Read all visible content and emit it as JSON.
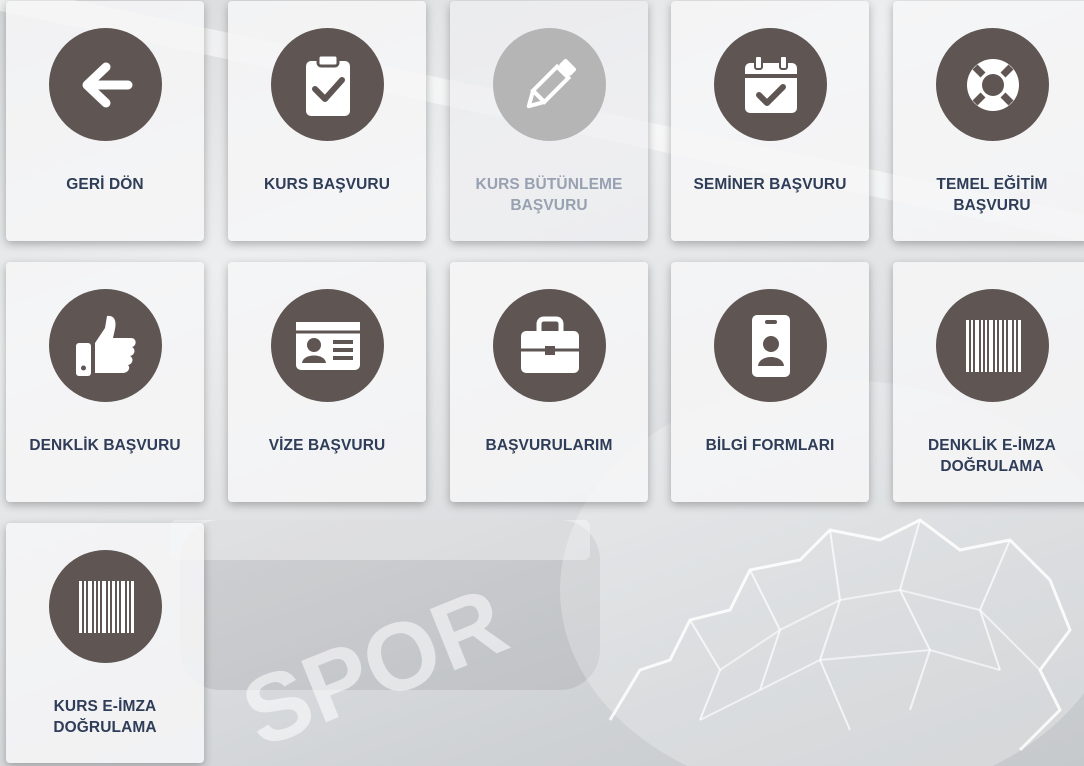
{
  "background": {
    "watermark": "SPOR"
  },
  "tiles": [
    {
      "label": "GERİ DÖN",
      "icon": "arrow-left-icon",
      "enabled": true
    },
    {
      "label": "KURS BAŞVURU",
      "icon": "clipboard-check-icon",
      "enabled": true
    },
    {
      "label": "KURS BÜTÜNLEME BAŞVURU",
      "icon": "pencil-icon",
      "enabled": false
    },
    {
      "label": "SEMİNER BAŞVURU",
      "icon": "calendar-check-icon",
      "enabled": true
    },
    {
      "label": "TEMEL EĞİTİM BAŞVURU",
      "icon": "life-ring-icon",
      "enabled": true
    },
    {
      "label": "DENKLİK BAŞVURU",
      "icon": "thumbs-up-icon",
      "enabled": true
    },
    {
      "label": "VİZE BAŞVURU",
      "icon": "id-card-icon",
      "enabled": true
    },
    {
      "label": "BAŞVURULARIM",
      "icon": "briefcase-icon",
      "enabled": true
    },
    {
      "label": "BİLGİ FORMLARI",
      "icon": "id-badge-icon",
      "enabled": true
    },
    {
      "label": "DENKLİK E-İMZA DOĞRULAMA",
      "icon": "barcode-icon",
      "enabled": true
    },
    {
      "label": "KURS E-İMZA DOĞRULAMA",
      "icon": "barcode-icon",
      "enabled": true
    }
  ],
  "colors": {
    "circle": "#5f5654",
    "circle_disabled": "#b5b5b6",
    "label": "#2f3d58",
    "label_disabled": "#97a1b1"
  }
}
